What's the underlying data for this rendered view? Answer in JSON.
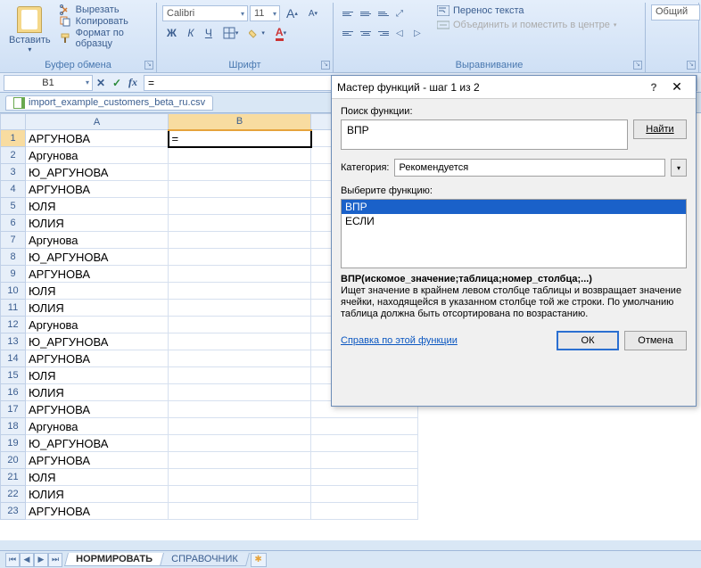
{
  "ribbon": {
    "clipboard": {
      "title": "Буфер обмена",
      "paste_label": "Вставить",
      "cut_label": "Вырезать",
      "copy_label": "Копировать",
      "fmt_label": "Формат по образцу"
    },
    "font": {
      "title": "Шрифт",
      "name": "Calibri",
      "size": "11",
      "grow": "A",
      "shrink": "A",
      "bold": "Ж",
      "italic": "К",
      "underline": "Ч",
      "font_color": "A"
    },
    "align": {
      "title": "Выравнивание",
      "wrap": "Перенос текста",
      "merge": "Объединить и поместить в центре"
    },
    "number": {
      "title": "",
      "format": "Общий"
    }
  },
  "formula_bar": {
    "name_box": "B1",
    "cancel": "✕",
    "enter": "✓",
    "fx": "fx",
    "formula": "="
  },
  "file": {
    "name": "import_example_customers_beta_ru.csv"
  },
  "columns": [
    "A",
    "B",
    ""
  ],
  "rows": [
    {
      "n": 1,
      "a": "АРГУНОВА",
      "b": "="
    },
    {
      "n": 2,
      "a": "Аргунова",
      "b": ""
    },
    {
      "n": 3,
      "a": "Ю_АРГУНОВА",
      "b": ""
    },
    {
      "n": 4,
      "a": " АРГУНОВА",
      "b": ""
    },
    {
      "n": 5,
      "a": "ЮЛЯ",
      "b": ""
    },
    {
      "n": 6,
      "a": "ЮЛИЯ",
      "b": ""
    },
    {
      "n": 7,
      "a": "Аргунова",
      "b": ""
    },
    {
      "n": 8,
      "a": "Ю_АРГУНОВА",
      "b": ""
    },
    {
      "n": 9,
      "a": " АРГУНОВА",
      "b": ""
    },
    {
      "n": 10,
      "a": "ЮЛЯ",
      "b": ""
    },
    {
      "n": 11,
      "a": "ЮЛИЯ",
      "b": ""
    },
    {
      "n": 12,
      "a": "Аргунова",
      "b": ""
    },
    {
      "n": 13,
      "a": "Ю_АРГУНОВА",
      "b": ""
    },
    {
      "n": 14,
      "a": " АРГУНОВА",
      "b": ""
    },
    {
      "n": 15,
      "a": "ЮЛЯ",
      "b": ""
    },
    {
      "n": 16,
      "a": "ЮЛИЯ",
      "b": ""
    },
    {
      "n": 17,
      "a": "АРГУНОВА",
      "b": ""
    },
    {
      "n": 18,
      "a": "Аргунова",
      "b": ""
    },
    {
      "n": 19,
      "a": "Ю_АРГУНОВА",
      "b": ""
    },
    {
      "n": 20,
      "a": " АРГУНОВА",
      "b": ""
    },
    {
      "n": 21,
      "a": "ЮЛЯ",
      "b": ""
    },
    {
      "n": 22,
      "a": "ЮЛИЯ",
      "b": ""
    },
    {
      "n": 23,
      "a": "АРГУНОВА",
      "b": ""
    }
  ],
  "sheet_tabs": {
    "tab1": "НОРМИРОВАТЬ",
    "tab2": "СПРАВОЧНИК"
  },
  "dialog": {
    "title": "Мастер функций - шаг 1 из 2",
    "search_label": "Поиск функции:",
    "search_value": "ВПР",
    "find_btn": "Найти",
    "category_label": "Категория:",
    "category_value": "Рекомендуется",
    "select_label": "Выберите функцию:",
    "functions": [
      "ВПР",
      "ЕСЛИ"
    ],
    "syntax": "ВПР(искомое_значение;таблица;номер_столбца;...)",
    "description": "Ищет значение в крайнем левом столбце таблицы и возвращает значение ячейки, находящейся в указанном столбце той же строки. По умолчанию таблица должна быть отсортирована по возрастанию.",
    "help_link": "Справка по этой функции",
    "ok": "ОК",
    "cancel": "Отмена"
  }
}
